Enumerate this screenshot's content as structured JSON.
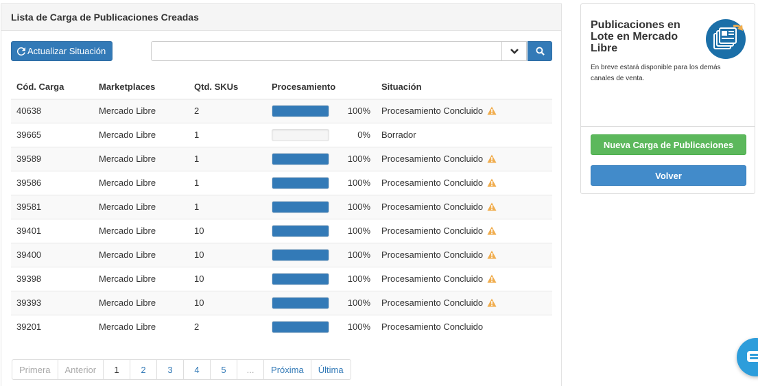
{
  "main": {
    "title": "Lista de Carga de Publicaciones Creadas",
    "update_button": "Actualizar Situación",
    "search_value": ""
  },
  "table": {
    "headers": [
      "Cód. Carga",
      "Marketplaces",
      "Qtd. SKUs",
      "Procesamiento",
      "Situación"
    ],
    "rows": [
      {
        "cod": "40638",
        "marketplace": "Mercado Libre",
        "skus": "2",
        "progress": 100,
        "pct": "100%",
        "status": "Procesamiento Concluido",
        "warning": true
      },
      {
        "cod": "39665",
        "marketplace": "Mercado Libre",
        "skus": "1",
        "progress": 0,
        "pct": "0%",
        "status": "Borrador",
        "warning": false
      },
      {
        "cod": "39589",
        "marketplace": "Mercado Libre",
        "skus": "1",
        "progress": 100,
        "pct": "100%",
        "status": "Procesamiento Concluido",
        "warning": true
      },
      {
        "cod": "39586",
        "marketplace": "Mercado Libre",
        "skus": "1",
        "progress": 100,
        "pct": "100%",
        "status": "Procesamiento Concluido",
        "warning": true
      },
      {
        "cod": "39581",
        "marketplace": "Mercado Libre",
        "skus": "1",
        "progress": 100,
        "pct": "100%",
        "status": "Procesamiento Concluido",
        "warning": true
      },
      {
        "cod": "39401",
        "marketplace": "Mercado Libre",
        "skus": "10",
        "progress": 100,
        "pct": "100%",
        "status": "Procesamiento Concluido",
        "warning": true
      },
      {
        "cod": "39400",
        "marketplace": "Mercado Libre",
        "skus": "10",
        "progress": 100,
        "pct": "100%",
        "status": "Procesamiento Concluido",
        "warning": true
      },
      {
        "cod": "39398",
        "marketplace": "Mercado Libre",
        "skus": "10",
        "progress": 100,
        "pct": "100%",
        "status": "Procesamiento Concluido",
        "warning": true
      },
      {
        "cod": "39393",
        "marketplace": "Mercado Libre",
        "skus": "10",
        "progress": 100,
        "pct": "100%",
        "status": "Procesamiento Concluido",
        "warning": true
      },
      {
        "cod": "39201",
        "marketplace": "Mercado Libre",
        "skus": "2",
        "progress": 100,
        "pct": "100%",
        "status": "Procesamiento Concluido",
        "warning": false
      }
    ]
  },
  "pagination": {
    "first": "Primera",
    "prev": "Anterior",
    "pages": [
      "1",
      "2",
      "3",
      "4",
      "5",
      "..."
    ],
    "active_page": "1",
    "next": "Próxima",
    "last": "Última"
  },
  "side": {
    "title": "Publicaciones en Lote en Mercado Libre",
    "description": "En breve estará disponible para los demás canales de venta.",
    "new_button": "Nueva Carga de Publicaciones",
    "back_button": "Volver",
    "icon": "stacked-documents-icon"
  },
  "colors": {
    "primary": "#337ab7",
    "success": "#5cb85c",
    "warning": "#f0ad4e",
    "chat": "#2d9ddb"
  }
}
